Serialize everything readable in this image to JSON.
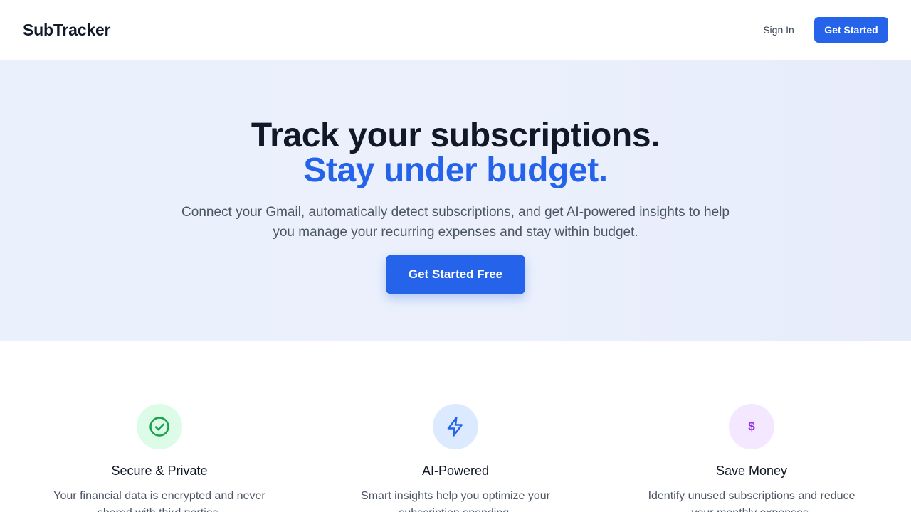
{
  "nav": {
    "brand": "SubTracker",
    "sign_in": "Sign In",
    "get_started": "Get Started"
  },
  "hero": {
    "headline_line1": "Track your subscriptions.",
    "headline_line2": "Stay under budget.",
    "subtitle": "Connect your Gmail, automatically detect subscriptions, and get AI-powered insights to help you manage your recurring expenses and stay within budget.",
    "cta": "Get Started Free"
  },
  "features": [
    {
      "icon": "check-circle-icon",
      "title": "Secure & Private",
      "description": "Your financial data is encrypted and never shared with third parties."
    },
    {
      "icon": "lightning-bolt-icon",
      "title": "AI-Powered",
      "description": "Smart insights help you optimize your subscription spending."
    },
    {
      "icon": "dollar-icon",
      "symbol": "$",
      "title": "Save Money",
      "description": "Identify unused subscriptions and reduce your monthly expenses."
    }
  ],
  "colors": {
    "primary": "#2563eb",
    "heading": "#111827",
    "body_text": "#4b5563",
    "green_bg": "#dcfce7",
    "green_icon": "#16a34a",
    "blue_bg": "#dbeafe",
    "purple_bg": "#f3e8ff",
    "purple_icon": "#9333ea"
  }
}
